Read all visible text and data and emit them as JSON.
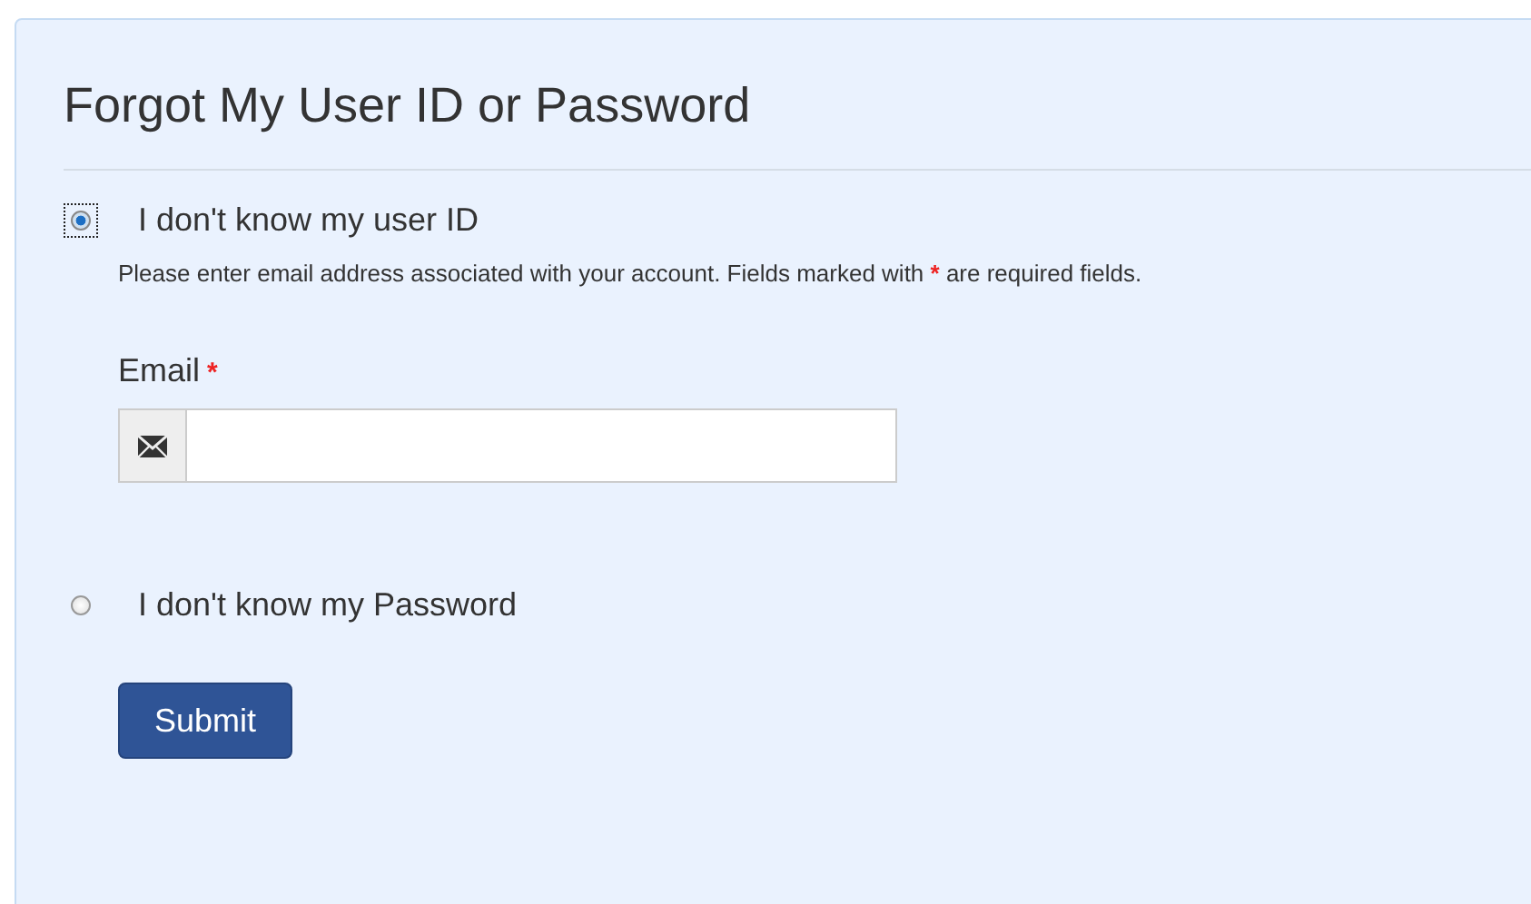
{
  "title": "Forgot My User ID or Password",
  "options": [
    {
      "label": "I don't know my user ID",
      "selected": true,
      "focused": true,
      "form": {
        "hint": {
          "before": "Please enter email address associated with your account. Fields marked with ",
          "mark": "*",
          "after": " are required fields."
        },
        "field": {
          "label": "Email",
          "required_mark": "*"
        }
      }
    },
    {
      "label": "I don't know my Password",
      "selected": false,
      "focused": false
    }
  ],
  "submit": "Submit"
}
